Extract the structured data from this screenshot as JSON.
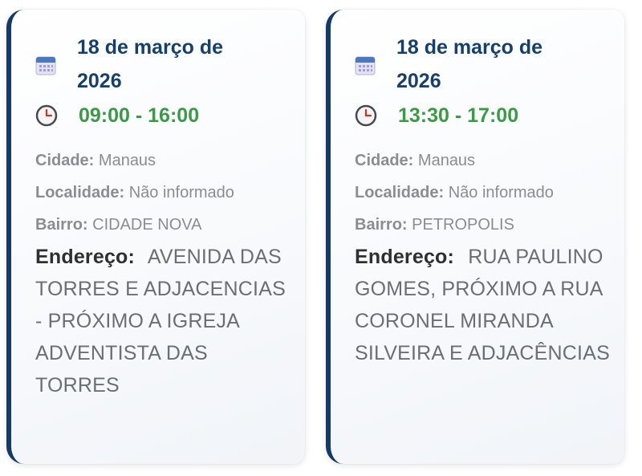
{
  "cards": [
    {
      "date": "18 de março de 2026",
      "time": "09:00 - 16:00",
      "city_label": "Cidade:",
      "city": "Manaus",
      "locality_label": "Localidade:",
      "locality": "Não informado",
      "district_label": "Bairro:",
      "district": "CIDADE NOVA",
      "address_label": "Endereço:",
      "address": "AVENIDA DAS TORRES E ADJACENCIAS - PRÓXIMO A IGREJA ADVENTISTA DAS TORRES"
    },
    {
      "date": "18 de março de 2026",
      "time": "13:30 - 17:00",
      "city_label": "Cidade:",
      "city": "Manaus",
      "locality_label": "Localidade:",
      "locality": "Não informado",
      "district_label": "Bairro:",
      "district": "PETROPOLIS",
      "address_label": "Endereço:",
      "address": "RUA PAULINO GOMES, PRÓXIMO A RUA CORONEL MIRANDA SILVEIRA E ADJACÊNCIAS"
    }
  ],
  "icons": {
    "date": "calendar-icon",
    "time": "clock-icon"
  },
  "colors": {
    "accent_border": "#153a66",
    "date_text": "#163f6b",
    "time_text": "#3a9a45",
    "label_text": "#8a8d91",
    "address_label": "#2f2f2f"
  }
}
